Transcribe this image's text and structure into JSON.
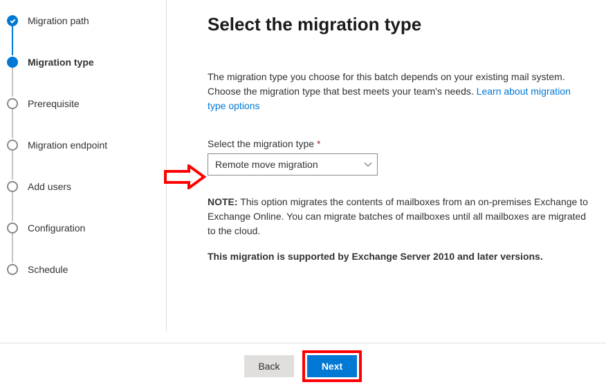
{
  "steps": [
    {
      "label": "Migration path"
    },
    {
      "label": "Migration type"
    },
    {
      "label": "Prerequisite"
    },
    {
      "label": "Migration endpoint"
    },
    {
      "label": "Add users"
    },
    {
      "label": "Configuration"
    },
    {
      "label": "Schedule"
    }
  ],
  "main": {
    "heading": "Select the migration type",
    "desc_text": "The migration type you choose for this batch depends on your existing mail system. Choose the migration type that best meets your team's needs. ",
    "desc_link": "Learn about migration type options",
    "field_label": "Select the migration type ",
    "required_mark": "*",
    "select_value": "Remote move migration",
    "note_label": "NOTE:",
    "note_text": " This option migrates the contents of mailboxes from an on-premises Exchange to Exchange Online. You can migrate batches of mailboxes until all mailboxes are migrated to the cloud.",
    "support_text": "This migration is supported by Exchange Server 2010 and later versions."
  },
  "footer": {
    "back": "Back",
    "next": "Next"
  }
}
